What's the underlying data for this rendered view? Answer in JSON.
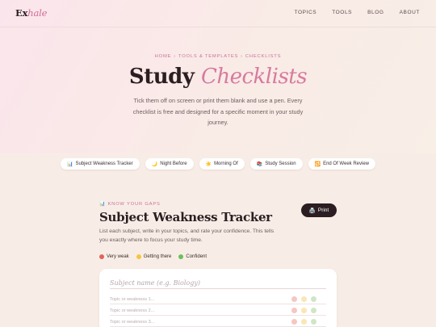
{
  "nav": {
    "logo_main": "Ex",
    "logo_accent": "hale",
    "links": [
      "TOPICS",
      "TOOLS",
      "BLOG",
      "ABOUT"
    ]
  },
  "breadcrumb": [
    "HOME",
    "TOOLS & TEMPLATES",
    "CHECKLISTS"
  ],
  "breadcrumb_separator": "›",
  "hero": {
    "title_main": "Study",
    "title_accent": "Checklists",
    "subtitle": "Tick them off on screen or print them blank and use a pen. Every checklist is free and designed for a specific moment in your study journey."
  },
  "pills": [
    {
      "icon": "📊",
      "icon_name": "bar-chart-icon",
      "label": "Subject Weakness Tracker"
    },
    {
      "icon": "🌙",
      "icon_name": "moon-icon",
      "label": "Night Before"
    },
    {
      "icon": "☀️",
      "icon_name": "sun-icon",
      "label": "Morning Of"
    },
    {
      "icon": "📚",
      "icon_name": "books-icon",
      "label": "Study Session"
    },
    {
      "icon": "🔁",
      "icon_name": "repeat-icon",
      "label": "End Of Week Review"
    }
  ],
  "section": {
    "kicker_icon": "📊",
    "kicker": "KNOW YOUR GAPS",
    "title": "Subject Weakness Tracker",
    "description": "List each subject, write in your topics, and rate your confidence. This tells you exactly where to focus your study time.",
    "print_icon": "🖨️",
    "print_label": "Print"
  },
  "legend": [
    {
      "label": "Very weak",
      "color": "#e0645c"
    },
    {
      "label": "Getting there",
      "color": "#f4c542"
    },
    {
      "label": "Confident",
      "color": "#6cbf5b"
    }
  ],
  "card": {
    "subject_placeholder": "Subject name (e.g. Biology)",
    "topic_rows": [
      {
        "placeholder": "Topic or weakness 1..."
      },
      {
        "placeholder": "Topic or weakness 2..."
      },
      {
        "placeholder": "Topic or weakness 3..."
      }
    ],
    "rating_colors": [
      "#f6c6c3",
      "#f9e7b4",
      "#cfe6c6"
    ]
  },
  "colors": {
    "accent": "#d77aa0",
    "dark": "#2b1d21",
    "background": "#f8ede6"
  }
}
